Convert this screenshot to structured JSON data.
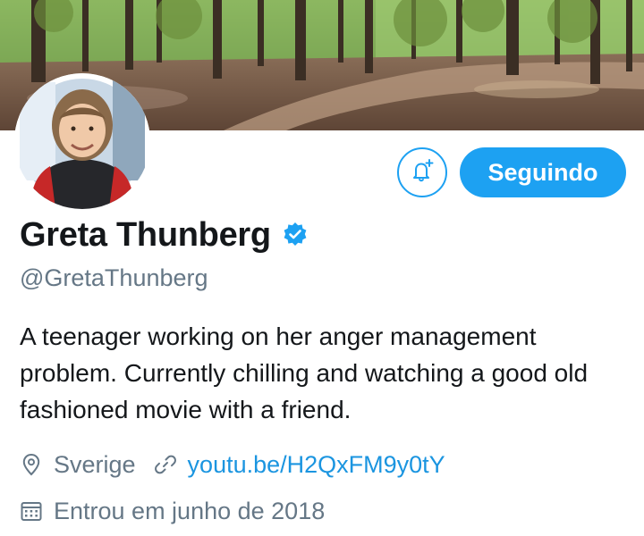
{
  "profile": {
    "name": "Greta Thunberg",
    "handle": "@GretaThunberg",
    "verified": true,
    "bio": "A teenager working on her anger management problem. Currently chilling and watching a good old fashioned movie with a friend.",
    "location": "Sverige",
    "website": "youtu.be/H2QxFM9y0tY",
    "joined": "Entrou em junho de 2018"
  },
  "actions": {
    "follow_label": "Seguindo",
    "notify_icon": "bell-plus-icon"
  },
  "icons": {
    "verified": "verified-badge-icon",
    "location": "location-pin-icon",
    "link": "link-icon",
    "calendar": "calendar-icon"
  },
  "colors": {
    "accent": "#1da1f2",
    "link": "#1b95e0",
    "text": "#14171a",
    "secondary": "#657786"
  }
}
